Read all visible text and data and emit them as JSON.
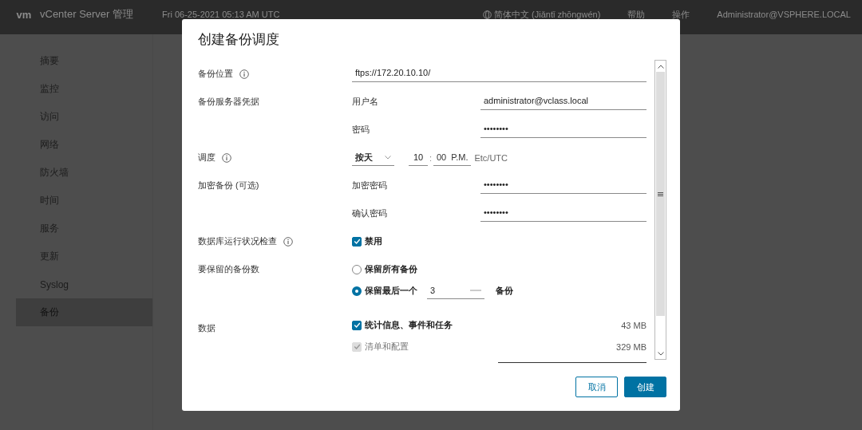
{
  "header": {
    "logo": "vm",
    "title": "vCenter Server 管理",
    "datetime": "Fri 06-25-2021 05:13 AM UTC",
    "language": "简体中文 (Jiǎntǐ zhōngwén)",
    "help": "帮助",
    "actions": "操作",
    "user": "Administrator@VSPHERE.LOCAL"
  },
  "sidebar": {
    "items": [
      {
        "label": "摘要",
        "selected": false
      },
      {
        "label": "监控",
        "selected": false
      },
      {
        "label": "访问",
        "selected": false
      },
      {
        "label": "网络",
        "selected": false
      },
      {
        "label": "防火墙",
        "selected": false
      },
      {
        "label": "时间",
        "selected": false
      },
      {
        "label": "服务",
        "selected": false
      },
      {
        "label": "更新",
        "selected": false
      },
      {
        "label": "Syslog",
        "selected": false
      },
      {
        "label": "备份",
        "selected": true
      }
    ]
  },
  "dialog": {
    "title": "创建备份调度",
    "rows": [
      {
        "kind": "text-field",
        "label": "备份位置",
        "info": true,
        "value": "ftps://172.20.10.10/"
      },
      {
        "kind": "credentials",
        "label": "备份服务器凭据",
        "info": false,
        "fields": [
          {
            "label": "用户名",
            "value": "administrator@vclass.local"
          },
          {
            "label": "密码",
            "value": "••••••••"
          }
        ]
      },
      {
        "kind": "schedule",
        "label": "调度",
        "info": true,
        "frequency": "按天",
        "hour": "10",
        "separator": ":",
        "minute": "00",
        "ampm": "P.M.",
        "timezone": "Etc/UTC"
      },
      {
        "kind": "credentials",
        "label": "加密备份 (可选)",
        "info": false,
        "fields": [
          {
            "label": "加密密码",
            "value": "••••••••"
          },
          {
            "label": "确认密码",
            "value": "••••••••"
          }
        ]
      },
      {
        "kind": "checkbox",
        "label": "数据库运行状况检查",
        "info": true,
        "option": {
          "text": "禁用",
          "checked": true
        }
      },
      {
        "kind": "radio",
        "label": "要保留的备份数",
        "info": false,
        "options": [
          {
            "text": "保留所有备份",
            "selected": false
          },
          {
            "text": "保留最后一个",
            "selected": true,
            "count": "3",
            "unit": "备份"
          }
        ]
      },
      {
        "kind": "data",
        "label": "数据",
        "info": false,
        "items": [
          {
            "text": "统计信息、事件和任务",
            "checked": true,
            "disabled": false,
            "size": "43 MB"
          },
          {
            "text": "清单和配置",
            "checked": true,
            "disabled": true,
            "size": "329 MB"
          }
        ]
      }
    ],
    "buttons": [
      {
        "label": "取消",
        "kind": "secondary"
      },
      {
        "label": "创建",
        "kind": "primary"
      }
    ]
  }
}
